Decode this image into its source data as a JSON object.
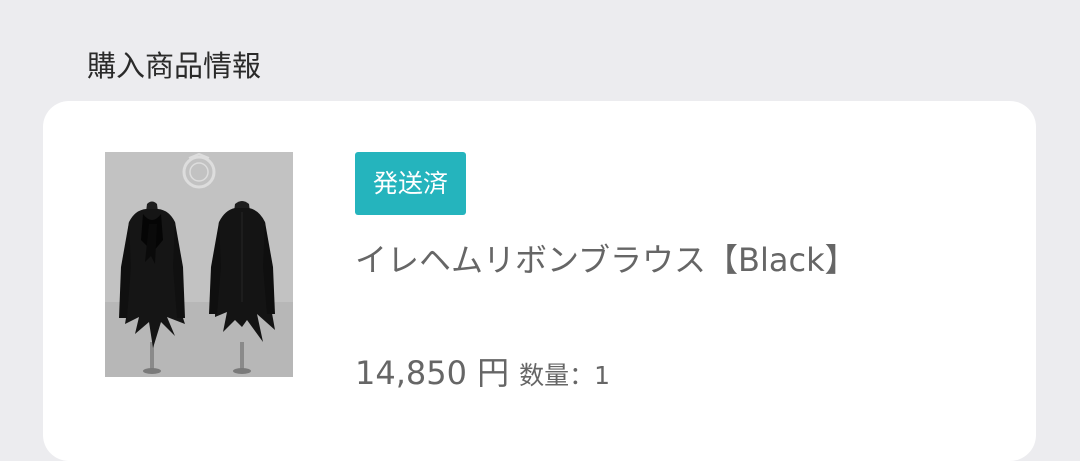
{
  "section": {
    "title": "購入商品情報"
  },
  "order_item": {
    "status": "発送済",
    "status_color": "#25b4bd",
    "product_name": "イレヘムリボンブラウス【Black】",
    "price": "14,850 円",
    "quantity_label": "数量：",
    "quantity": "1",
    "image_icon": "product-photo-black-blouse"
  }
}
